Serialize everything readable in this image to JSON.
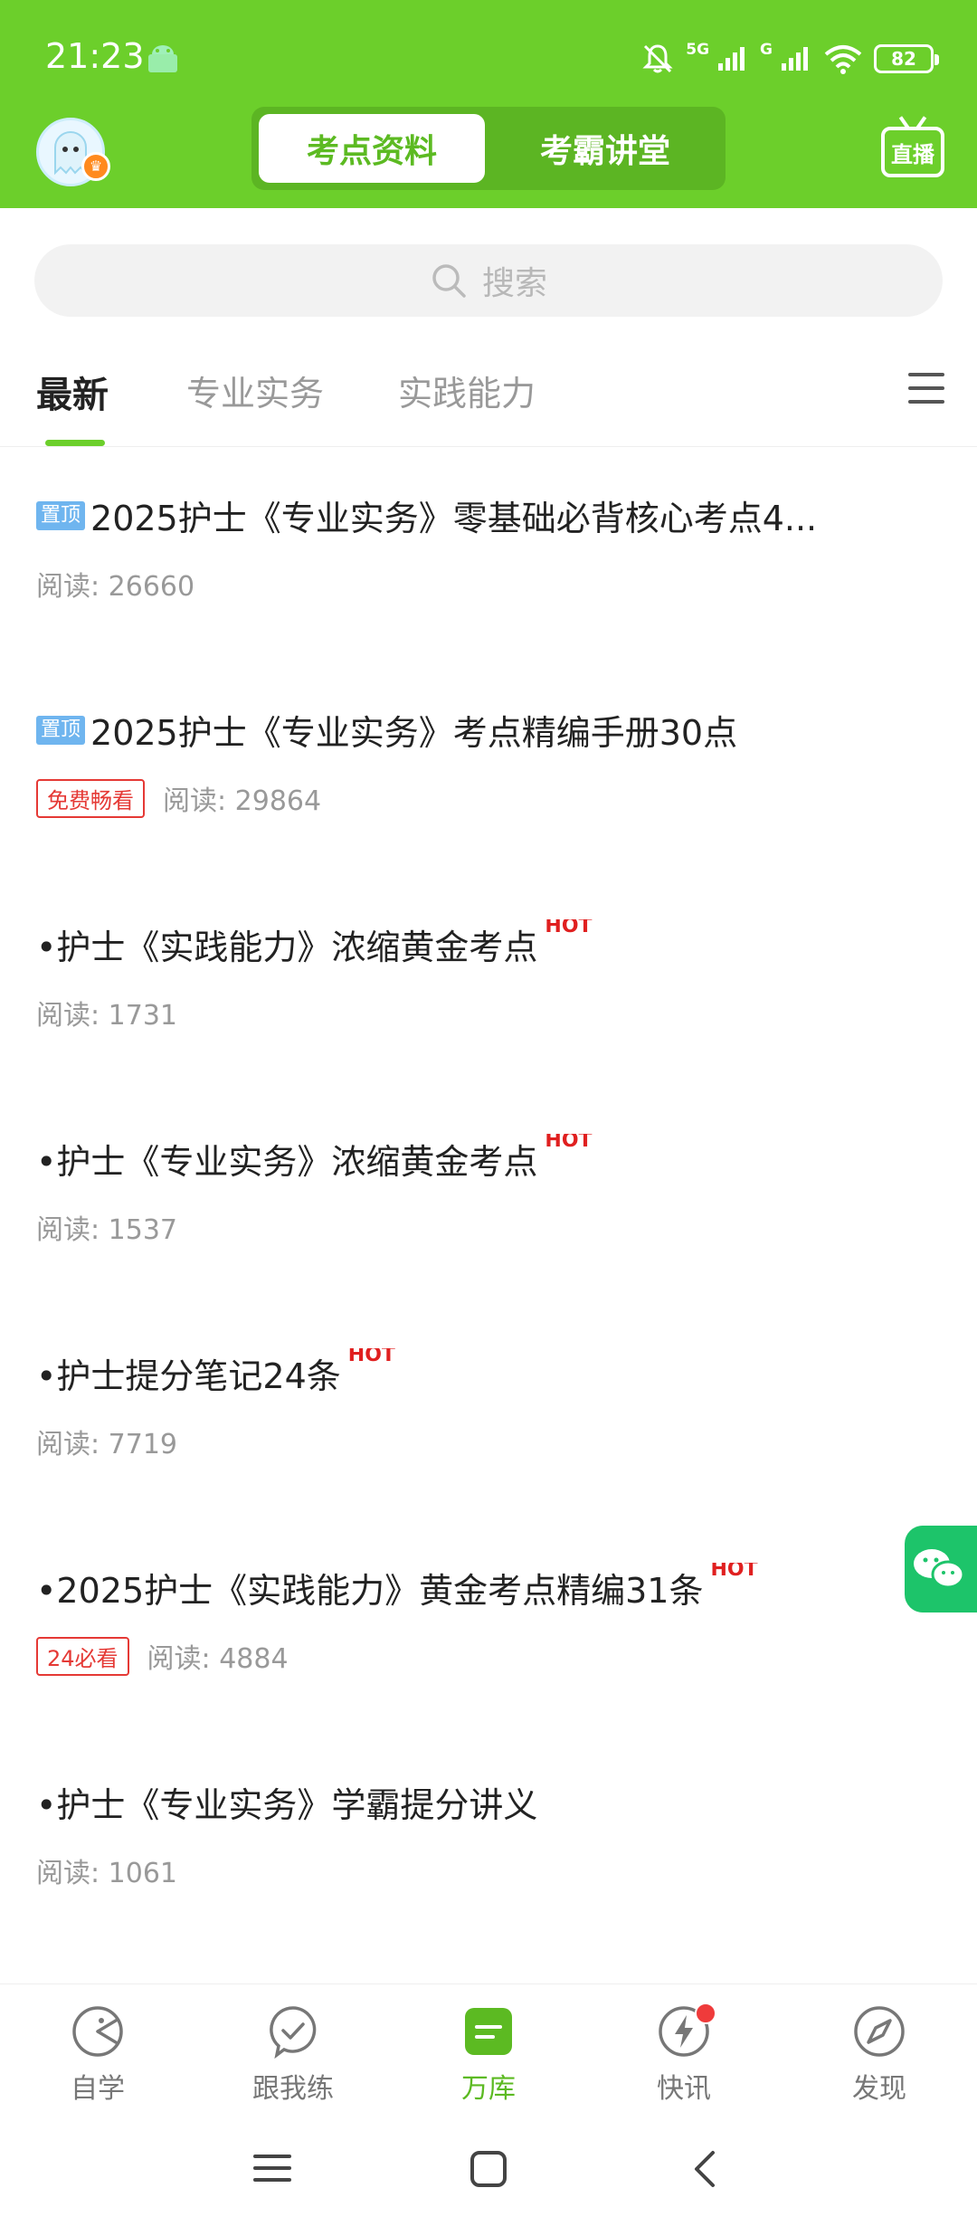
{
  "status_bar": {
    "time": "21:23",
    "signal_1": "5G",
    "signal_2": "G",
    "battery": "82"
  },
  "header": {
    "tabs": [
      {
        "label": "考点资料",
        "active": true
      },
      {
        "label": "考霸讲堂",
        "active": false
      }
    ],
    "live_label": "直播"
  },
  "search": {
    "placeholder": "搜索"
  },
  "categories": {
    "tabs": [
      {
        "label": "最新",
        "active": true
      },
      {
        "label": "专业实务",
        "active": false
      },
      {
        "label": "实践能力",
        "active": false
      }
    ]
  },
  "articles": [
    {
      "pinned_label": "置顶",
      "title": "2025护士《专业实务》零基础必背核心考点4...",
      "hot": "",
      "badge": "",
      "read": "阅读: 26660"
    },
    {
      "pinned_label": "置顶",
      "title": "2025护士《专业实务》考点精编手册30点",
      "hot": "",
      "badge": "免费畅看",
      "read": "阅读: 29864"
    },
    {
      "pinned_label": "",
      "title": "•护士《实践能力》浓缩黄金考点",
      "hot": "HOT",
      "badge": "",
      "read": "阅读: 1731"
    },
    {
      "pinned_label": "",
      "title": "•护士《专业实务》浓缩黄金考点",
      "hot": "HOT",
      "badge": "",
      "read": "阅读: 1537"
    },
    {
      "pinned_label": "",
      "title": "•护士提分笔记24条",
      "hot": "HOT",
      "badge": "",
      "read": "阅读: 7719"
    },
    {
      "pinned_label": "",
      "title": "•2025护士《实践能力》黄金考点精编31条",
      "hot": "HOT",
      "badge": "24必看",
      "read": "阅读: 4884"
    },
    {
      "pinned_label": "",
      "title": "•护士《专业实务》学霸提分讲义",
      "hot": "",
      "badge": "",
      "read": "阅读: 1061"
    }
  ],
  "bottom_nav": {
    "items": [
      {
        "label": "自学",
        "icon": "self-study-icon"
      },
      {
        "label": "跟我练",
        "icon": "practice-icon"
      },
      {
        "label": "万库",
        "icon": "library-icon",
        "active": true
      },
      {
        "label": "快讯",
        "icon": "flash-news-icon",
        "notification": true
      },
      {
        "label": "发现",
        "icon": "compass-icon"
      }
    ]
  },
  "colors": {
    "brand_green": "#6ccf2b",
    "hot_red": "#e02020",
    "pin_blue": "#6fb5ef"
  }
}
